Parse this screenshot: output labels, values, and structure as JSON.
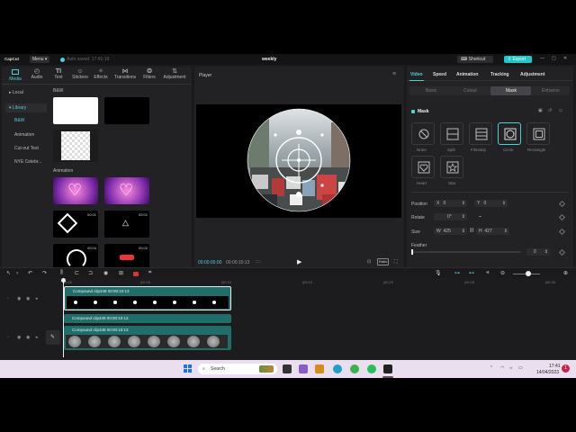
{
  "window": {
    "app_name": "CapCut",
    "menu_label": "Menu",
    "autosave": "Auto saved: 17:41:19",
    "project_title": "weekly",
    "shortcut_label": "Shortcut",
    "export_label": "Export"
  },
  "toolbar": {
    "tabs": [
      {
        "label": "Media",
        "icon": "media-icon",
        "active": true
      },
      {
        "label": "Audio",
        "icon": "audio-icon"
      },
      {
        "label": "Text",
        "icon": "text-icon"
      },
      {
        "label": "Stickers",
        "icon": "stickers-icon"
      },
      {
        "label": "Effects",
        "icon": "effects-icon"
      },
      {
        "label": "Transitions",
        "icon": "transitions-icon"
      },
      {
        "label": "Filters",
        "icon": "filters-icon"
      },
      {
        "label": "Adjustment",
        "icon": "adjustment-icon"
      }
    ]
  },
  "library": {
    "nav": [
      "Local",
      "Library",
      "B&W",
      "Animation",
      "Cut-out Text",
      "NYE Celebr..."
    ],
    "sections": {
      "bw": "B&W",
      "animation": "Animation"
    },
    "durations": [
      "00:01",
      "00:04",
      "00:02"
    ]
  },
  "player": {
    "title": "Player",
    "current_time": "00:00:00:00",
    "total_time": "00:00:10:13",
    "ratio_label": "Ratio"
  },
  "inspector": {
    "tabs": [
      "Video",
      "Speed",
      "Animation",
      "Tracking",
      "Adjustment"
    ],
    "subtabs": [
      "Basic",
      "Cutout",
      "Mask",
      "Enhance"
    ],
    "mask_title": "Mask",
    "shapes": [
      "None",
      "Split",
      "Filmstrip",
      "Circle",
      "Rectangle",
      "Heart",
      "Star"
    ],
    "selected_shape": "Circle",
    "position_label": "Position",
    "pos_x_label": "X",
    "pos_x": "0",
    "pos_y_label": "Y",
    "pos_y": "0",
    "rotate_label": "Rotate",
    "rotate": "0°",
    "size_label": "Size",
    "size_w_label": "W",
    "size_w": "425",
    "size_h_label": "H",
    "size_h": "427",
    "feather_label": "Feather",
    "feather": "0",
    "feather_value": 0
  },
  "timeline": {
    "ruler": [
      "00:00",
      "|00:05",
      "|00:10",
      "|00:15",
      "|00:20",
      "|00:25",
      "|00:30"
    ],
    "clip_label": "Compound clip348  00:00:10:13"
  },
  "taskbar": {
    "search": "Search",
    "time": "17:41",
    "date": "14/04/2023",
    "notification_count": "1"
  },
  "colors": {
    "accent": "#4fd0d6",
    "clip": "#1f6e6a",
    "export": "#22c7c7"
  }
}
